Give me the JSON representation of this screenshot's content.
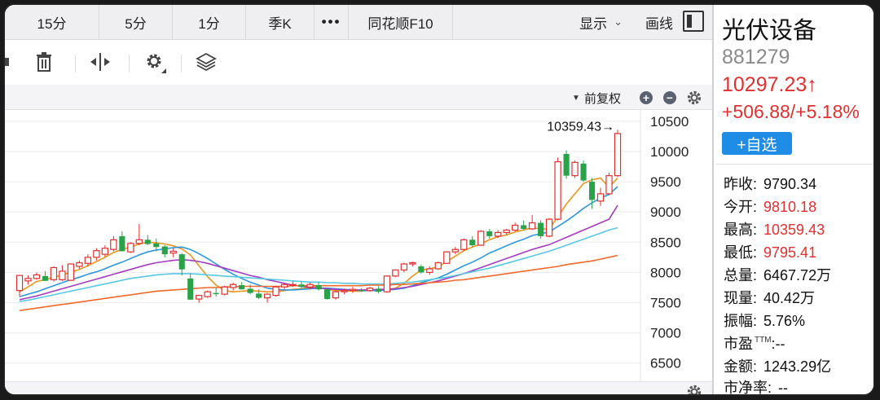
{
  "tabs": [
    "15分",
    "5分",
    "1分",
    "季K",
    "•••",
    "同花顺F10"
  ],
  "tabs_right": {
    "display": "显示",
    "draw": "画线"
  },
  "subheader": {
    "fq": "前复权"
  },
  "chart_data": {
    "type": "candlestick",
    "y_ticks": [
      "10500",
      "10000",
      "9500",
      "9000",
      "8500",
      "8000",
      "7500",
      "7000",
      "6500"
    ],
    "ylim": [
      6200,
      10700
    ],
    "annotation": "10359.43→",
    "candles": [
      [
        7700,
        7950,
        7600,
        7950
      ],
      [
        7860,
        7950,
        7800,
        7900
      ],
      [
        7900,
        8000,
        7880,
        7960
      ],
      [
        7940,
        8020,
        7900,
        7860
      ],
      [
        7880,
        8100,
        7850,
        8080
      ],
      [
        7880,
        8120,
        7860,
        8020
      ],
      [
        7870,
        8150,
        7860,
        8140
      ],
      [
        8100,
        8200,
        8060,
        8160
      ],
      [
        8150,
        8300,
        8100,
        8250
      ],
      [
        8250,
        8400,
        8200,
        8360
      ],
      [
        8300,
        8450,
        8260,
        8400
      ],
      [
        8380,
        8600,
        8350,
        8540
      ],
      [
        8600,
        8680,
        8400,
        8350
      ],
      [
        8340,
        8500,
        8320,
        8480
      ],
      [
        8480,
        8800,
        8450,
        8540
      ],
      [
        8540,
        8620,
        8450,
        8470
      ],
      [
        8480,
        8560,
        8350,
        8420
      ],
      [
        8430,
        8450,
        8250,
        8300
      ],
      [
        8320,
        8400,
        8250,
        8350
      ],
      [
        8300,
        8320,
        7950,
        8050
      ],
      [
        7900,
        7980,
        7550,
        7550
      ],
      [
        7560,
        7620,
        7500,
        7620
      ],
      [
        7600,
        7700,
        7580,
        7680
      ],
      [
        7660,
        7750,
        7600,
        7640
      ],
      [
        7640,
        7780,
        7620,
        7760
      ],
      [
        7750,
        7830,
        7700,
        7800
      ],
      [
        7790,
        7840,
        7720,
        7720
      ],
      [
        7730,
        7800,
        7640,
        7660
      ],
      [
        7650,
        7720,
        7560,
        7580
      ],
      [
        7580,
        7660,
        7500,
        7640
      ],
      [
        7620,
        7780,
        7600,
        7760
      ],
      [
        7760,
        7820,
        7720,
        7800
      ],
      [
        7790,
        7850,
        7760,
        7800
      ],
      [
        7800,
        7850,
        7740,
        7760
      ],
      [
        7760,
        7830,
        7720,
        7800
      ],
      [
        7790,
        7840,
        7700,
        7720
      ],
      [
        7720,
        7730,
        7550,
        7560
      ],
      [
        7580,
        7700,
        7550,
        7680
      ],
      [
        7680,
        7730,
        7640,
        7700
      ],
      [
        7700,
        7760,
        7660,
        7720
      ],
      [
        7710,
        7740,
        7680,
        7700
      ],
      [
        7700,
        7760,
        7680,
        7740
      ],
      [
        7730,
        7780,
        7650,
        7680
      ],
      [
        7680,
        7950,
        7660,
        7940
      ],
      [
        7940,
        8050,
        7920,
        8040
      ],
      [
        8040,
        8160,
        8000,
        8140
      ],
      [
        8140,
        8180,
        8100,
        8160
      ],
      [
        8100,
        8130,
        7980,
        8000
      ],
      [
        8000,
        8100,
        7960,
        8060
      ],
      [
        8060,
        8180,
        8040,
        8160
      ],
      [
        8150,
        8350,
        8140,
        8340
      ],
      [
        8340,
        8420,
        8300,
        8380
      ],
      [
        8380,
        8560,
        8350,
        8540
      ],
      [
        8540,
        8600,
        8420,
        8450
      ],
      [
        8450,
        8700,
        8440,
        8680
      ],
      [
        8680,
        8720,
        8560,
        8600
      ],
      [
        8600,
        8700,
        8570,
        8660
      ],
      [
        8660,
        8720,
        8620,
        8700
      ],
      [
        8700,
        8820,
        8680,
        8780
      ],
      [
        8780,
        8860,
        8700,
        8720
      ],
      [
        8720,
        8950,
        8700,
        8820
      ],
      [
        8820,
        8860,
        8560,
        8600
      ],
      [
        8600,
        8900,
        8580,
        8880
      ],
      [
        8880,
        9900,
        8860,
        9830
      ],
      [
        9960,
        10020,
        9550,
        9600
      ],
      [
        9600,
        9850,
        9560,
        9820
      ],
      [
        9800,
        9850,
        9500,
        9520
      ],
      [
        9500,
        9560,
        9050,
        9200
      ],
      [
        9180,
        9400,
        9100,
        9300
      ],
      [
        9300,
        9650,
        9280,
        9600
      ],
      [
        9600,
        10359.43,
        9580,
        10297.23
      ]
    ],
    "ma_series": [
      {
        "color": "#e8961e",
        "values": [
          7680,
          7760,
          7850,
          7880,
          7920,
          7960,
          8000,
          8050,
          8110,
          8180,
          8250,
          8330,
          8380,
          8420,
          8470,
          8500,
          8490,
          8470,
          8440,
          8390,
          8290,
          8110,
          7930,
          7790,
          7700,
          7680,
          7690,
          7700,
          7690,
          7680,
          7680,
          7700,
          7720,
          7730,
          7750,
          7760,
          7720,
          7700,
          7700,
          7690,
          7690,
          7710,
          7710,
          7710,
          7740,
          7820,
          7940,
          8040,
          8060,
          8090,
          8180,
          8270,
          8360,
          8420,
          8470,
          8540,
          8590,
          8620,
          8670,
          8700,
          8740,
          8720,
          8720,
          8920,
          9130,
          9300,
          9470,
          9530,
          9560,
          9410,
          9560
        ]
      },
      {
        "color": "#2c97de",
        "values": [
          7600,
          7640,
          7680,
          7730,
          7780,
          7830,
          7880,
          7920,
          7970,
          8010,
          8060,
          8120,
          8170,
          8230,
          8290,
          8340,
          8370,
          8390,
          8410,
          8420,
          8380,
          8310,
          8230,
          8140,
          8050,
          7970,
          7900,
          7840,
          7790,
          7740,
          7720,
          7710,
          7710,
          7720,
          7730,
          7740,
          7740,
          7730,
          7720,
          7710,
          7700,
          7700,
          7700,
          7710,
          7720,
          7740,
          7780,
          7830,
          7870,
          7910,
          7970,
          8040,
          8110,
          8170,
          8240,
          8320,
          8380,
          8440,
          8500,
          8550,
          8610,
          8640,
          8670,
          8760,
          8850,
          8950,
          9060,
          9150,
          9230,
          9290,
          9420
        ]
      },
      {
        "color": "#a33dbd",
        "values": [
          7550,
          7580,
          7610,
          7650,
          7690,
          7730,
          7770,
          7810,
          7850,
          7890,
          7930,
          7970,
          8010,
          8050,
          8090,
          8130,
          8160,
          8180,
          8200,
          8210,
          8200,
          8180,
          8150,
          8110,
          8070,
          8030,
          7990,
          7950,
          7920,
          7880,
          7850,
          7820,
          7790,
          7770,
          7750,
          7740,
          7730,
          7720,
          7710,
          7710,
          7710,
          7710,
          7720,
          7720,
          7730,
          7750,
          7770,
          7800,
          7830,
          7860,
          7900,
          7940,
          7980,
          8030,
          8080,
          8130,
          8180,
          8230,
          8280,
          8330,
          8380,
          8420,
          8460,
          8520,
          8580,
          8640,
          8700,
          8760,
          8820,
          8880,
          9110
        ]
      },
      {
        "color": "#56c8e0",
        "values": [
          7520,
          7540,
          7570,
          7600,
          7630,
          7660,
          7690,
          7720,
          7750,
          7780,
          7810,
          7840,
          7870,
          7900,
          7920,
          7940,
          7960,
          7970,
          7980,
          7980,
          7980,
          7970,
          7960,
          7950,
          7940,
          7930,
          7920,
          7910,
          7900,
          7890,
          7880,
          7870,
          7860,
          7850,
          7840,
          7840,
          7830,
          7830,
          7820,
          7820,
          7810,
          7810,
          7810,
          7810,
          7820,
          7830,
          7840,
          7860,
          7880,
          7900,
          7920,
          7950,
          7980,
          8010,
          8040,
          8070,
          8110,
          8150,
          8190,
          8230,
          8270,
          8310,
          8350,
          8400,
          8450,
          8500,
          8550,
          8600,
          8650,
          8700,
          8740
        ]
      },
      {
        "color": "#f06a2b",
        "values": [
          7370,
          7390,
          7410,
          7430,
          7450,
          7470,
          7490,
          7510,
          7530,
          7550,
          7570,
          7590,
          7610,
          7630,
          7650,
          7670,
          7690,
          7700,
          7710,
          7720,
          7730,
          7740,
          7750,
          7750,
          7760,
          7760,
          7770,
          7770,
          7770,
          7770,
          7770,
          7770,
          7780,
          7780,
          7780,
          7780,
          7780,
          7780,
          7780,
          7780,
          7780,
          7790,
          7790,
          7790,
          7800,
          7800,
          7810,
          7820,
          7830,
          7840,
          7850,
          7870,
          7880,
          7900,
          7920,
          7940,
          7960,
          7980,
          8000,
          8020,
          8040,
          8060,
          8080,
          8100,
          8130,
          8150,
          8170,
          8190,
          8220,
          8250,
          8280
        ]
      }
    ]
  },
  "panel": {
    "name": "光伏设备",
    "code": "881279",
    "price": "10297.23↑",
    "change": "+506.88/+5.18%",
    "add": "+自选",
    "stats": [
      {
        "label": "昨收:",
        "value": "9790.34",
        "color": "blk"
      },
      {
        "label": "今开:",
        "value": "9810.18",
        "color": "red"
      },
      {
        "label": "最高:",
        "value": "10359.43",
        "color": "red"
      },
      {
        "label": "最低:",
        "value": "9795.41",
        "color": "red"
      },
      {
        "label": "总量:",
        "value": "6467.72万",
        "color": "blk"
      },
      {
        "label": "现量:",
        "value": "40.42万",
        "color": "blk"
      },
      {
        "label": "振幅:",
        "value": "5.76%",
        "color": "blk"
      },
      {
        "label": "市盈",
        "sup": "TTM",
        "value": ":--",
        "color": "blk"
      },
      {
        "label": "金额:",
        "value": "1243.29亿",
        "color": "blk"
      },
      {
        "label": "市净率:",
        "value": "--",
        "color": "blk"
      }
    ]
  }
}
